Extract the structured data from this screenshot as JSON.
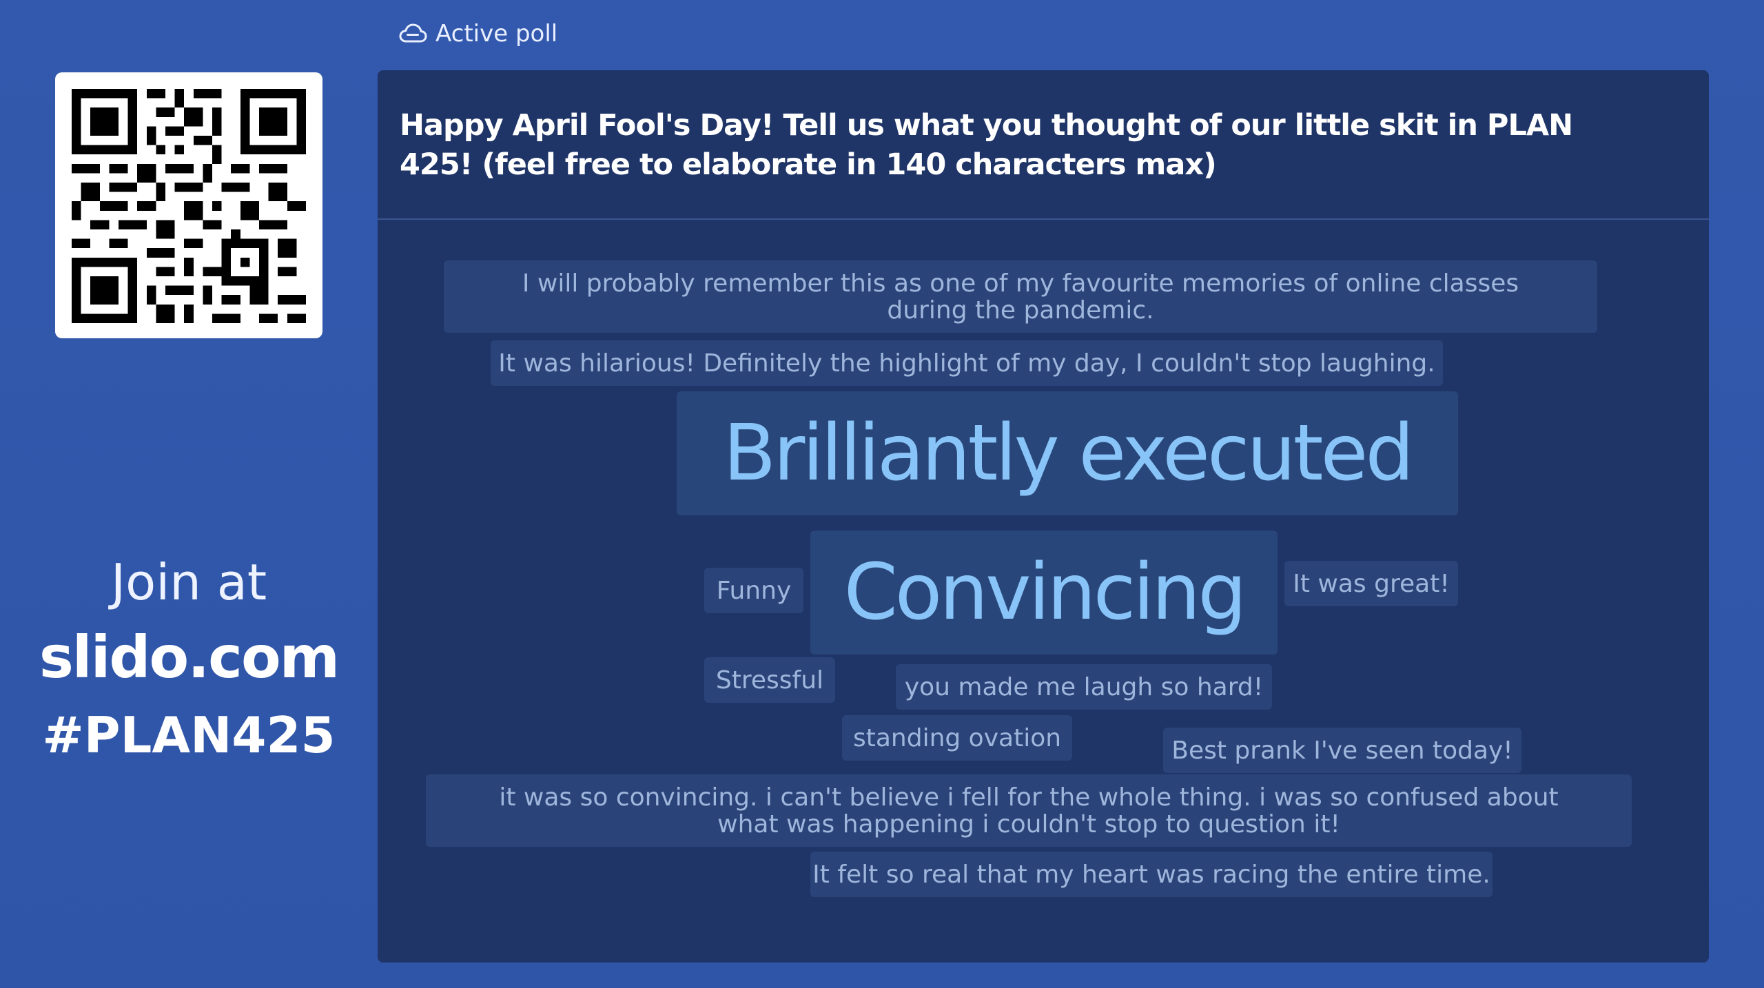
{
  "sidebar": {
    "join_label": "Join at",
    "join_url": "slido.com",
    "event_code": "#PLAN425"
  },
  "header": {
    "status_label": "Active poll",
    "status_icon": "cloud-poll-icon"
  },
  "poll": {
    "question": "Happy April Fool's Day! Tell us what you thought of our little skit in PLAN 425! (feel free to elaborate in 140 characters max)",
    "responses": [
      "I will probably remember this as one of my favourite memories of online classes during the pandemic.",
      "It was hilarious! Definitely the highlight of my day, I couldn't stop laughing.",
      "Brilliantly executed",
      "Funny",
      "Convincing",
      "It was great!",
      "Stressful",
      "you made me laugh so hard!",
      "standing ovation",
      "Best prank I've seen today!",
      "it was so convincing. i can't believe i fell for the whole thing. i was so confused about what was happening i couldn't stop to question it!",
      "It felt so real that my heart was racing the entire time."
    ]
  },
  "colors": {
    "background": "#3259ad",
    "panel": "#1f3467",
    "tile": "#2a4479",
    "tile_text": "#9fb6dc",
    "highlight_text": "#89c4f8"
  }
}
